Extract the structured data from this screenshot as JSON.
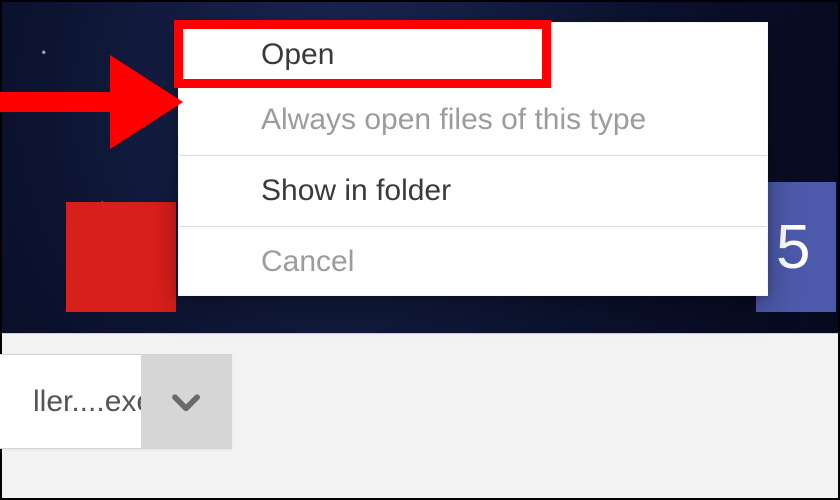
{
  "menu": {
    "open": "Open",
    "always_open": "Always open files of this type",
    "show_in_folder": "Show in folder",
    "cancel": "Cancel"
  },
  "download": {
    "filename": "ller....exe"
  },
  "banner": {
    "number_fragment": "5"
  },
  "colors": {
    "highlight": "#ff0000",
    "arrow": "#ff0000",
    "red_block": "#d91f1b",
    "blue_block": "#4d5aab"
  }
}
